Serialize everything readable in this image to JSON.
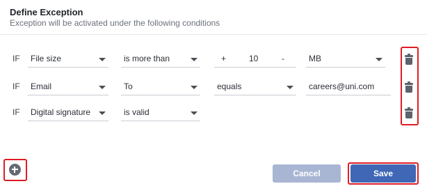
{
  "header": {
    "title": "Define Exception",
    "subtitle": "Exception will be activated under the following conditions"
  },
  "conditions": [
    {
      "keyword": "IF",
      "field": "File size",
      "operator": "is more than",
      "stepper": {
        "plus": "+",
        "value": "10",
        "minus": "-"
      },
      "unit": "MB"
    },
    {
      "keyword": "IF",
      "field": "Email",
      "operator": "To",
      "match": "equals",
      "value": "careers@uni.com"
    },
    {
      "keyword": "IF",
      "field": "Digital signature",
      "operator": "is valid"
    }
  ],
  "footer": {
    "cancel_label": "Cancel",
    "save_label": "Save"
  },
  "icons": {
    "delete": "trash-icon",
    "add": "plus-circle-icon"
  },
  "colors": {
    "primary": "#3f67b6",
    "disabled": "#a8b6d4",
    "highlight": "#e01b24",
    "icon": "#5d636b"
  }
}
